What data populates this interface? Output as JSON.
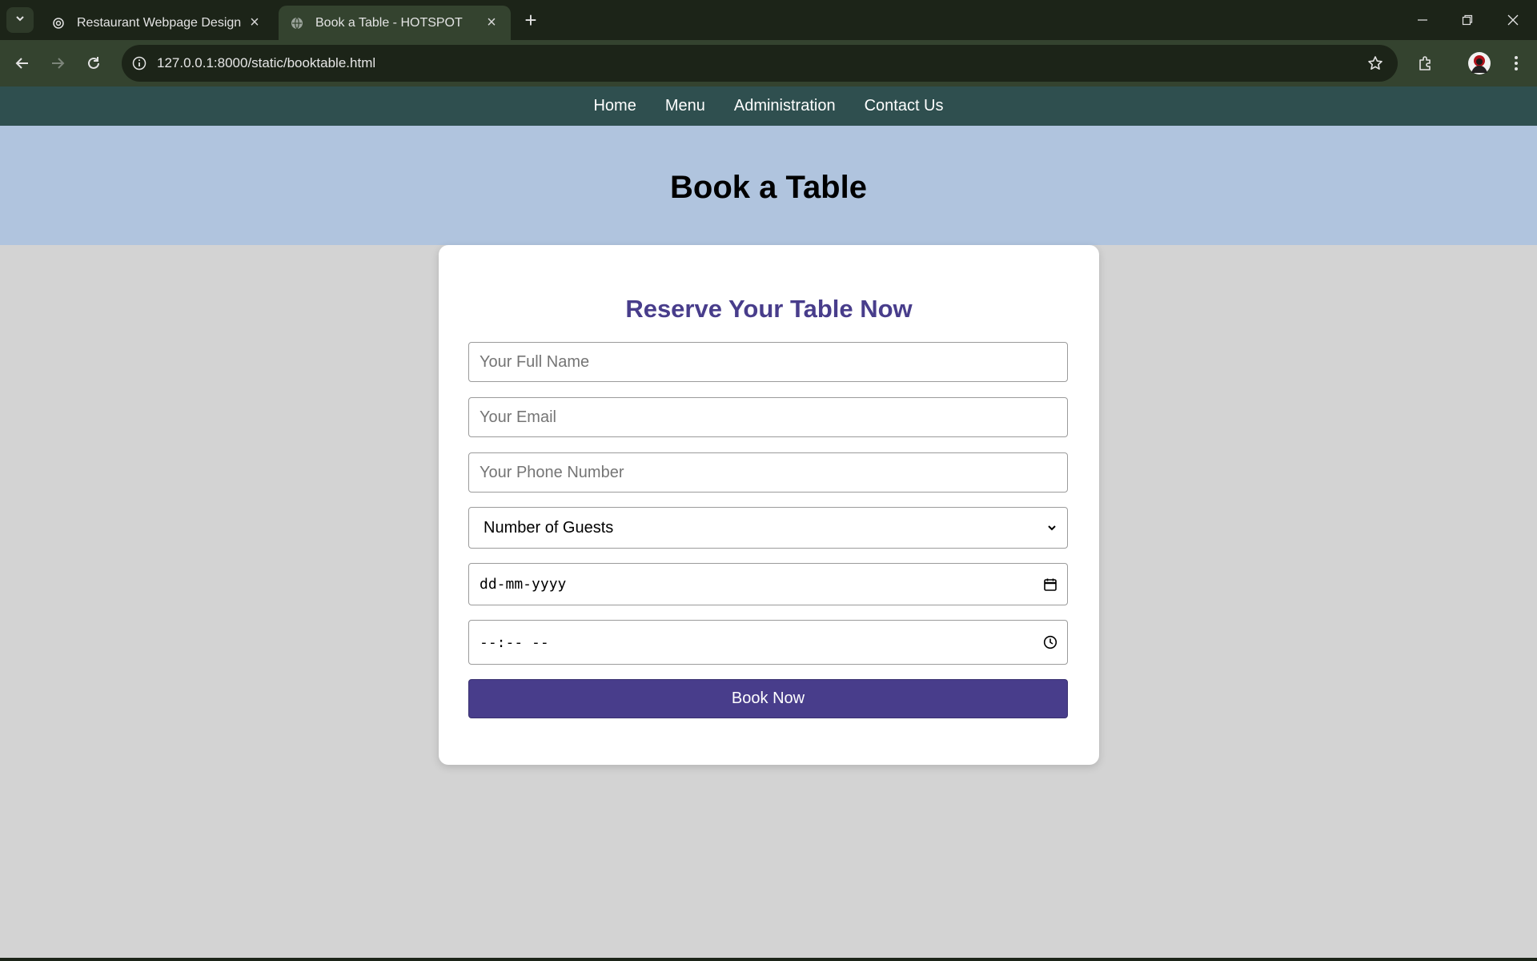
{
  "browser": {
    "tabs": [
      {
        "title": "Restaurant Webpage Design",
        "icon": "openai-icon"
      },
      {
        "title": "Book a Table - HOTSPOT",
        "icon": "globe-icon"
      }
    ],
    "url": "127.0.0.1:8000/static/booktable.html"
  },
  "nav": {
    "items": [
      "Home",
      "Menu",
      "Administration",
      "Contact Us"
    ]
  },
  "hero": {
    "title": "Book a Table"
  },
  "form": {
    "heading": "Reserve Your Table Now",
    "name_placeholder": "Your Full Name",
    "email_placeholder": "Your Email",
    "phone_placeholder": "Your Phone Number",
    "guests_selected": "Number of Guests",
    "date_placeholder": "dd-mm-yyyy",
    "time_placeholder": "--:-- --",
    "submit_label": "Book Now"
  },
  "colors": {
    "nav_bg": "#2f4f4f",
    "hero_bg": "#b0c4de",
    "accent": "#483d8b",
    "page_bg": "#d3d3d3"
  }
}
